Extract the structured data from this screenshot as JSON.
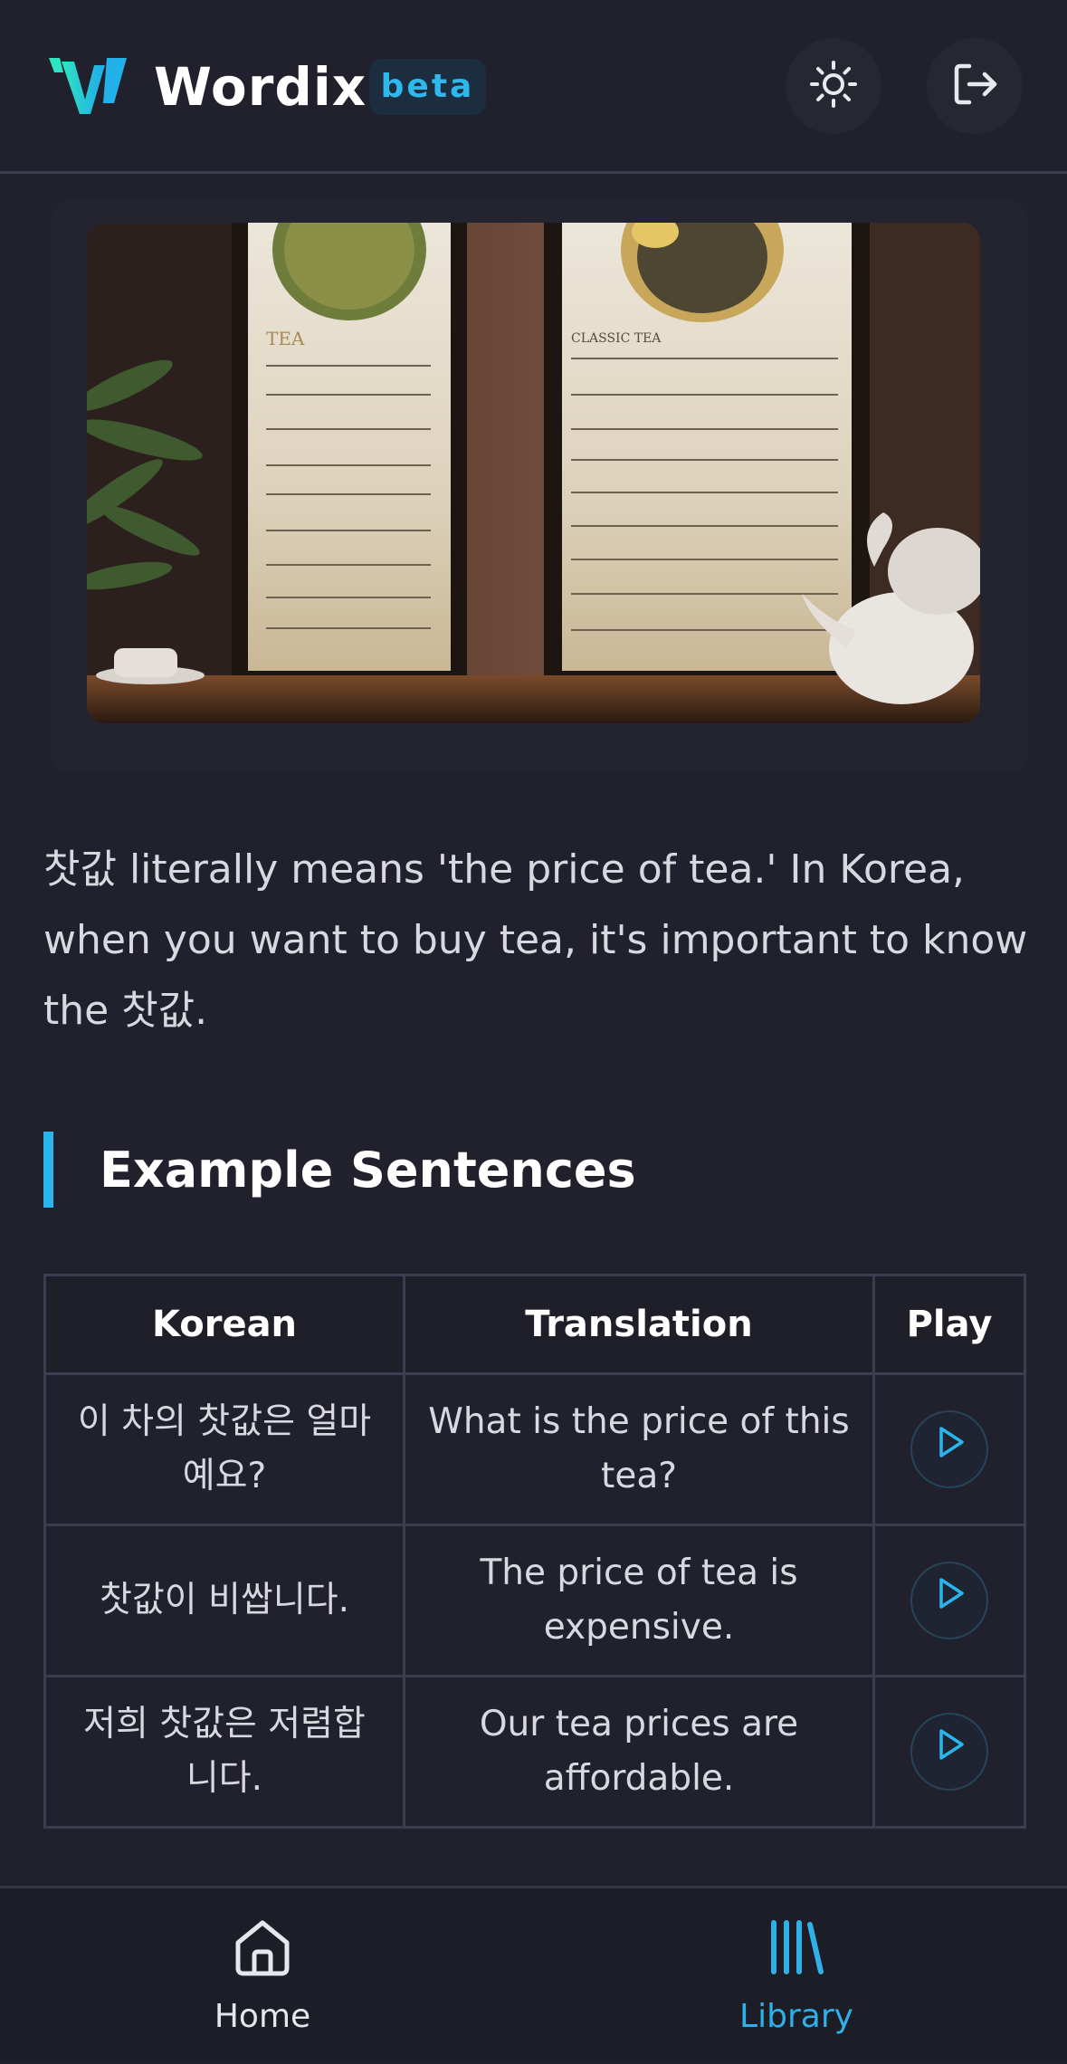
{
  "header": {
    "brand": "Wordix",
    "badge": "beta",
    "theme_icon": "sun-icon",
    "logout_icon": "logout-icon",
    "logo_icon": "wordix-w-logo"
  },
  "hero": {
    "image_alt": "Tea menu boards with bowls of tea leaves and white teapots"
  },
  "description": "찻값 literally means 'the price of tea.' In Korea, when you want to buy tea, it's important to know the 찻값.",
  "examples": {
    "title": "Example Sentences",
    "headers": {
      "korean": "Korean",
      "translation": "Translation",
      "play": "Play"
    },
    "rows": [
      {
        "korean": "이 차의 찻값은 얼마예요?",
        "translation": "What is the price of this tea?"
      },
      {
        "korean": "찻값이 비쌉니다.",
        "translation": "The price of tea is expensive."
      },
      {
        "korean": "저희 찻값은 저렴합니다.",
        "translation": "Our tea prices are affordable."
      }
    ],
    "play_icon": "play-icon"
  },
  "nav": {
    "items": [
      {
        "label": "Home",
        "icon": "home-icon",
        "active": false
      },
      {
        "label": "Library",
        "icon": "library-icon",
        "active": true
      }
    ]
  },
  "colors": {
    "background": "#20212c",
    "accent": "#2ab6ec",
    "logo_gradient_start": "#2fe0c4",
    "logo_gradient_end": "#21a9e8"
  }
}
